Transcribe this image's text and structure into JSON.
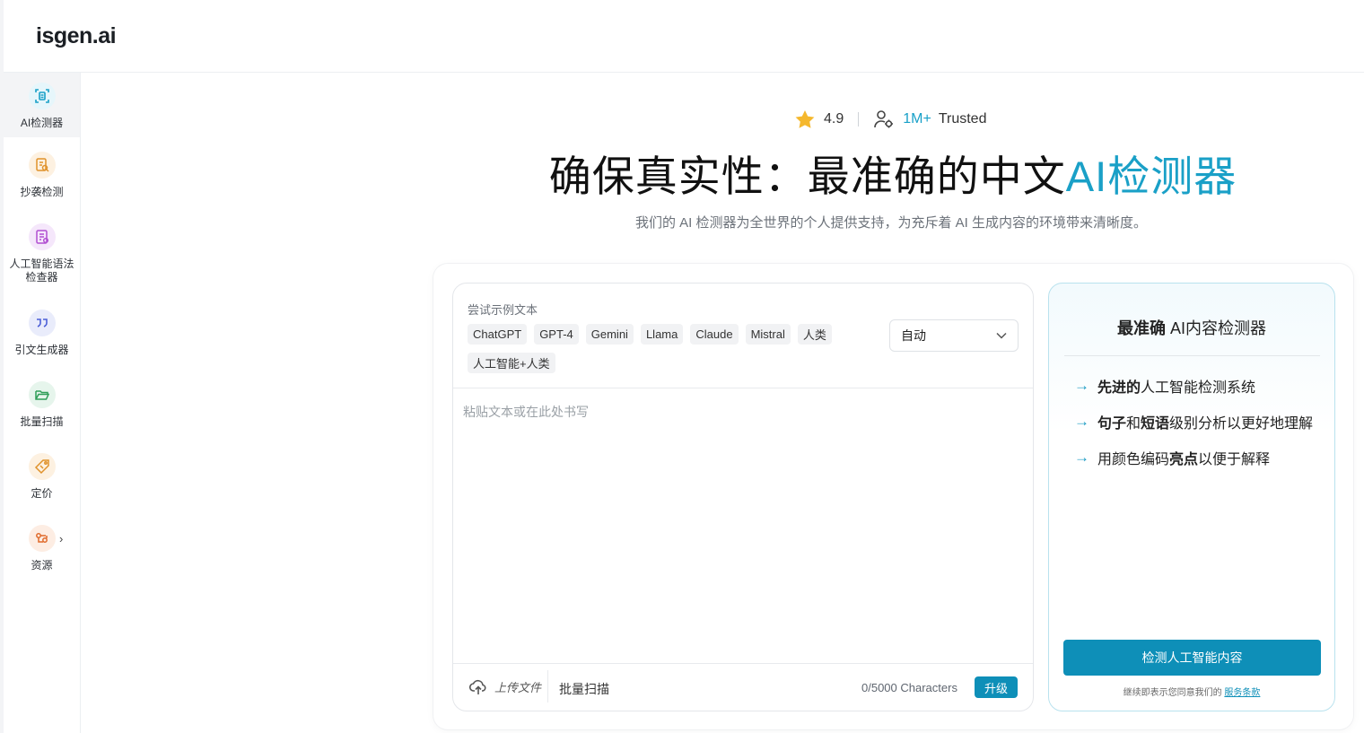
{
  "brand": {
    "logo": "isgen.ai"
  },
  "sidebar": {
    "items": [
      {
        "label": "AI检测器",
        "icon": "ai-detector-icon",
        "active": true,
        "color": "#1aa0c7",
        "bg": "#e6f6fb"
      },
      {
        "label": "抄袭检测",
        "icon": "plagiarism-check-icon",
        "active": false,
        "color": "#e0922b",
        "bg": "#fdf1e1"
      },
      {
        "label": "人工智能语法检查器",
        "icon": "grammar-checker-icon",
        "active": false,
        "color": "#b14fd1",
        "bg": "#f5e7fb"
      },
      {
        "label": "引文生成器",
        "icon": "citation-quote-icon",
        "active": false,
        "color": "#4c5fd7",
        "bg": "#e9ecfb"
      },
      {
        "label": "批量扫描",
        "icon": "folder-open-icon",
        "active": false,
        "color": "#2f9e58",
        "bg": "#e6f5ec"
      },
      {
        "label": "定价",
        "icon": "price-tag-icon",
        "active": false,
        "color": "#e0922b",
        "bg": "#fdf1e1"
      },
      {
        "label": "资源",
        "icon": "resources-icon",
        "active": false,
        "color": "#e06a2b",
        "bg": "#fdede3",
        "has_submenu": true
      }
    ]
  },
  "rating": {
    "score": "4.9",
    "users": "1M+",
    "trusted": "Trusted"
  },
  "hero": {
    "title_main": "确保真实性：最准确的中文",
    "title_accent": "AI检测器",
    "subtitle": "我们的 AI 检测器为全世界的个人提供支持，为充斥着 AI 生成内容的环境带来清晰度。"
  },
  "editor": {
    "samples_label": "尝试示例文本",
    "samples": [
      "ChatGPT",
      "GPT-4",
      "Gemini",
      "Llama",
      "Claude",
      "Mistral",
      "人类",
      "人工智能+人类"
    ],
    "language_select": "自动",
    "placeholder": "粘贴文本或在此处书写",
    "upload_label": "上传文件",
    "batch_label": "批量扫描",
    "char_count": "0/5000 Characters",
    "upgrade_label": "升级"
  },
  "panel": {
    "title_bold": "最准确",
    "title_rest": " AI内容检测器",
    "features": [
      {
        "parts": [
          {
            "t": "先进的",
            "b": true
          },
          {
            "t": " 人工智能检测系统",
            "b": false
          }
        ]
      },
      {
        "parts": [
          {
            "t": "句子",
            "b": true
          },
          {
            "t": "和",
            "b": false
          },
          {
            "t": "短语",
            "b": true
          },
          {
            "t": "级别分析以更好地理解",
            "b": false
          }
        ]
      },
      {
        "parts": [
          {
            "t": "用颜色编码",
            "b": false
          },
          {
            "t": "亮点",
            "b": true
          },
          {
            "t": "以便于解释",
            "b": false
          }
        ]
      }
    ],
    "detect_button": "检测人工智能内容",
    "terms_prefix": "继续即表示您同意我们的",
    "terms_link": "服务条款"
  },
  "colors": {
    "accent": "#1aa0c7",
    "button": "#0e8fb8",
    "star": "#f5b82e"
  }
}
